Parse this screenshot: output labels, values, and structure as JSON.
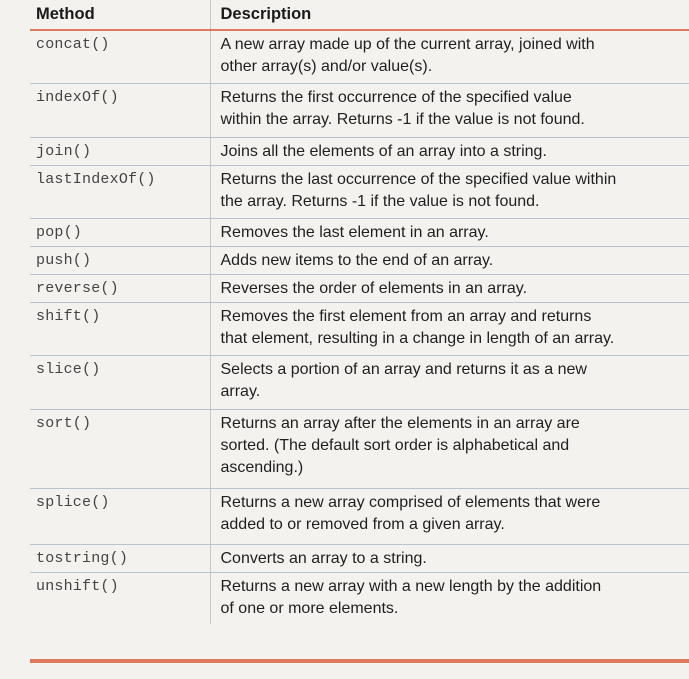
{
  "table": {
    "headers": {
      "method": "Method",
      "description": "Description"
    },
    "rows": [
      {
        "method": "concat()",
        "description": "A new array made up of the current array, joined with\nother array(s) and/or value(s)."
      },
      {
        "method": "indexOf()",
        "description": "Returns the first occurrence of the specified value\nwithin the array. Returns -1 if the value is not found."
      },
      {
        "method": "join()",
        "description": "Joins all the elements of an array into a string."
      },
      {
        "method": "lastIndexOf()",
        "description": "Returns the last occurrence of the specified value within\nthe array. Returns -1 if the value is not found."
      },
      {
        "method": "pop()",
        "description": "Removes the last element in an array."
      },
      {
        "method": "push()",
        "description": "Adds new items to the end of an array."
      },
      {
        "method": "reverse()",
        "description": "Reverses the order of elements in an array."
      },
      {
        "method": "shift()",
        "description": "Removes the first element from an array and returns\nthat element, resulting in a change in length of an array."
      },
      {
        "method": "slice()",
        "description": "Selects a portion of an array and returns it as a new\narray."
      },
      {
        "method": "sort()",
        "description": "Returns an array after the elements in an array are\nsorted. (The default sort order is alphabetical and\nascending.)"
      },
      {
        "method": "splice()",
        "description": "Returns a new array comprised of elements that were\nadded to or removed from a given array."
      },
      {
        "method": "tostring()",
        "description": "Converts an array to a string."
      },
      {
        "method": "unshift()",
        "description": "Returns a new array with a new length by the addition\nof one or more elements."
      }
    ]
  },
  "colors": {
    "accent_rule": "#e07a5f",
    "row_divider": "#b9c3cf"
  }
}
